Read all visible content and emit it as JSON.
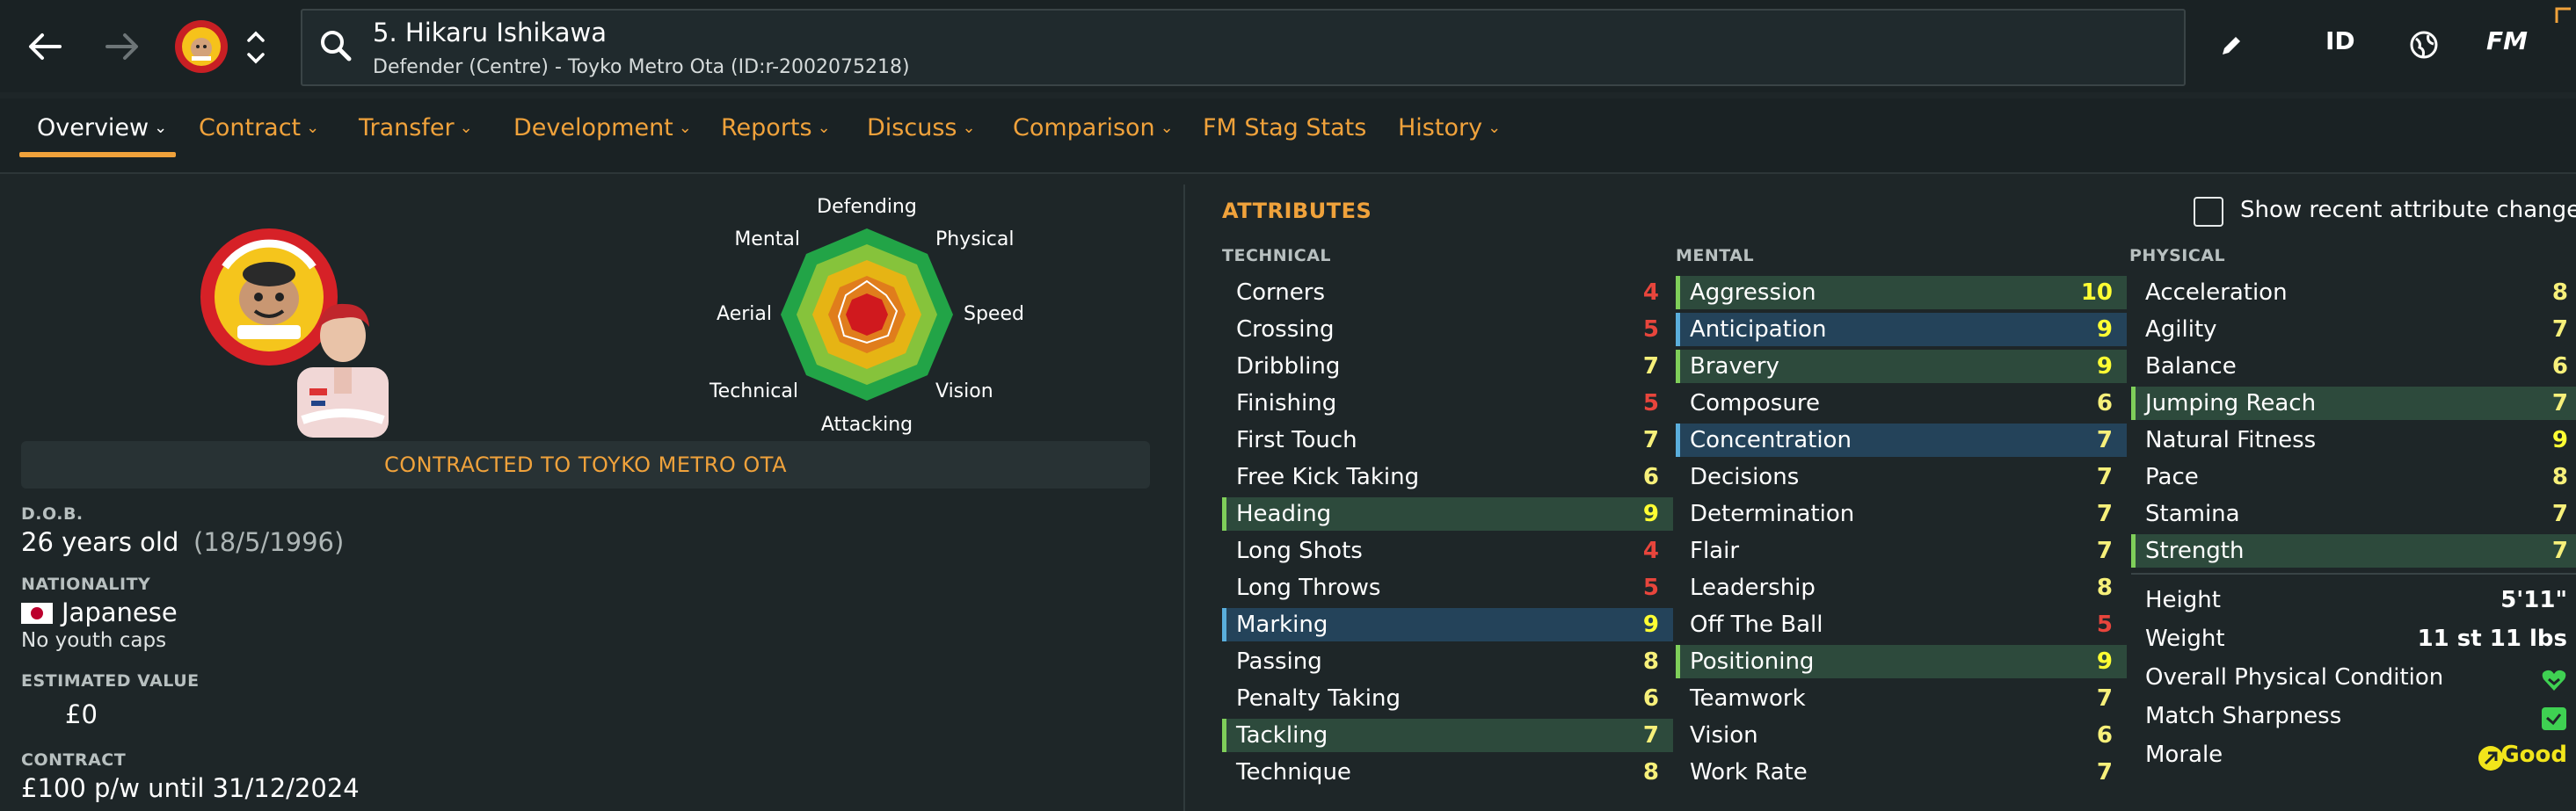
{
  "header": {
    "player_title": "5. Hikaru Ishikawa",
    "player_subtitle": "Defender (Centre) - Toyko Metro Ota (ID:r-2002075218)",
    "top_icons": [
      "ID",
      "FM"
    ]
  },
  "tabs": [
    {
      "label": "Overview",
      "dropdown": true
    },
    {
      "label": "Contract",
      "dropdown": true
    },
    {
      "label": "Transfer",
      "dropdown": true
    },
    {
      "label": "Development",
      "dropdown": true
    },
    {
      "label": "Reports",
      "dropdown": true
    },
    {
      "label": "Discuss",
      "dropdown": true
    },
    {
      "label": "Comparison",
      "dropdown": true
    },
    {
      "label": "FM Stag Stats",
      "dropdown": false
    },
    {
      "label": "History",
      "dropdown": true
    }
  ],
  "radar": {
    "labels": [
      "Defending",
      "Physical",
      "Speed",
      "Vision",
      "Attacking",
      "Technical",
      "Aerial",
      "Mental"
    ]
  },
  "profile": {
    "contract_banner": "CONTRACTED TO TOYKO METRO OTA",
    "dob_label": "D.O.B.",
    "age": "26 years old",
    "dob": "(18/5/1996)",
    "nationality_label": "NATIONALITY",
    "nationality": "Japanese",
    "youth_caps": "No youth caps",
    "value_label": "ESTIMATED VALUE",
    "value": "£0",
    "contract_label": "CONTRACT",
    "contract": "£100 p/w until 31/12/2024"
  },
  "attributes": {
    "heading": "ATTRIBUTES",
    "recent_changes_label": "Show recent attribute changes",
    "technical_label": "TECHNICAL",
    "mental_label": "MENTAL",
    "physical_label": "PHYSICAL",
    "technical": [
      {
        "name": "Corners",
        "value": "4",
        "hl": ""
      },
      {
        "name": "Crossing",
        "value": "5",
        "hl": ""
      },
      {
        "name": "Dribbling",
        "value": "7",
        "hl": ""
      },
      {
        "name": "Finishing",
        "value": "5",
        "hl": ""
      },
      {
        "name": "First Touch",
        "value": "7",
        "hl": ""
      },
      {
        "name": "Free Kick Taking",
        "value": "6",
        "hl": ""
      },
      {
        "name": "Heading",
        "value": "9",
        "hl": "green"
      },
      {
        "name": "Long Shots",
        "value": "4",
        "hl": ""
      },
      {
        "name": "Long Throws",
        "value": "5",
        "hl": ""
      },
      {
        "name": "Marking",
        "value": "9",
        "hl": "blue"
      },
      {
        "name": "Passing",
        "value": "8",
        "hl": ""
      },
      {
        "name": "Penalty Taking",
        "value": "6",
        "hl": ""
      },
      {
        "name": "Tackling",
        "value": "7",
        "hl": "green"
      },
      {
        "name": "Technique",
        "value": "8",
        "hl": ""
      }
    ],
    "mental": [
      {
        "name": "Aggression",
        "value": "10",
        "hl": "green"
      },
      {
        "name": "Anticipation",
        "value": "9",
        "hl": "blue"
      },
      {
        "name": "Bravery",
        "value": "9",
        "hl": "green"
      },
      {
        "name": "Composure",
        "value": "6",
        "hl": ""
      },
      {
        "name": "Concentration",
        "value": "7",
        "hl": "blue"
      },
      {
        "name": "Decisions",
        "value": "7",
        "hl": ""
      },
      {
        "name": "Determination",
        "value": "7",
        "hl": ""
      },
      {
        "name": "Flair",
        "value": "7",
        "hl": ""
      },
      {
        "name": "Leadership",
        "value": "8",
        "hl": ""
      },
      {
        "name": "Off The Ball",
        "value": "5",
        "hl": ""
      },
      {
        "name": "Positioning",
        "value": "9",
        "hl": "green"
      },
      {
        "name": "Teamwork",
        "value": "7",
        "hl": ""
      },
      {
        "name": "Vision",
        "value": "6",
        "hl": ""
      },
      {
        "name": "Work Rate",
        "value": "7",
        "hl": ""
      }
    ],
    "physical": [
      {
        "name": "Acceleration",
        "value": "8",
        "hl": ""
      },
      {
        "name": "Agility",
        "value": "7",
        "hl": ""
      },
      {
        "name": "Balance",
        "value": "6",
        "hl": ""
      },
      {
        "name": "Jumping Reach",
        "value": "7",
        "hl": "green"
      },
      {
        "name": "Natural Fitness",
        "value": "9",
        "hl": ""
      },
      {
        "name": "Pace",
        "value": "8",
        "hl": ""
      },
      {
        "name": "Stamina",
        "value": "7",
        "hl": ""
      },
      {
        "name": "Strength",
        "value": "7",
        "hl": "green"
      }
    ],
    "physical_extra": {
      "height_label": "Height",
      "height": "5'11\"",
      "weight_label": "Weight",
      "weight": "11 st 11 lbs",
      "condition_label": "Overall Physical Condition",
      "sharpness_label": "Match Sharpness",
      "morale_label": "Morale",
      "morale": "Good"
    }
  },
  "colors": {
    "accent": "#f0a23b",
    "val_low": "#e8453c",
    "val_mid": "#f7f07a",
    "val_high": "#ffff33"
  }
}
